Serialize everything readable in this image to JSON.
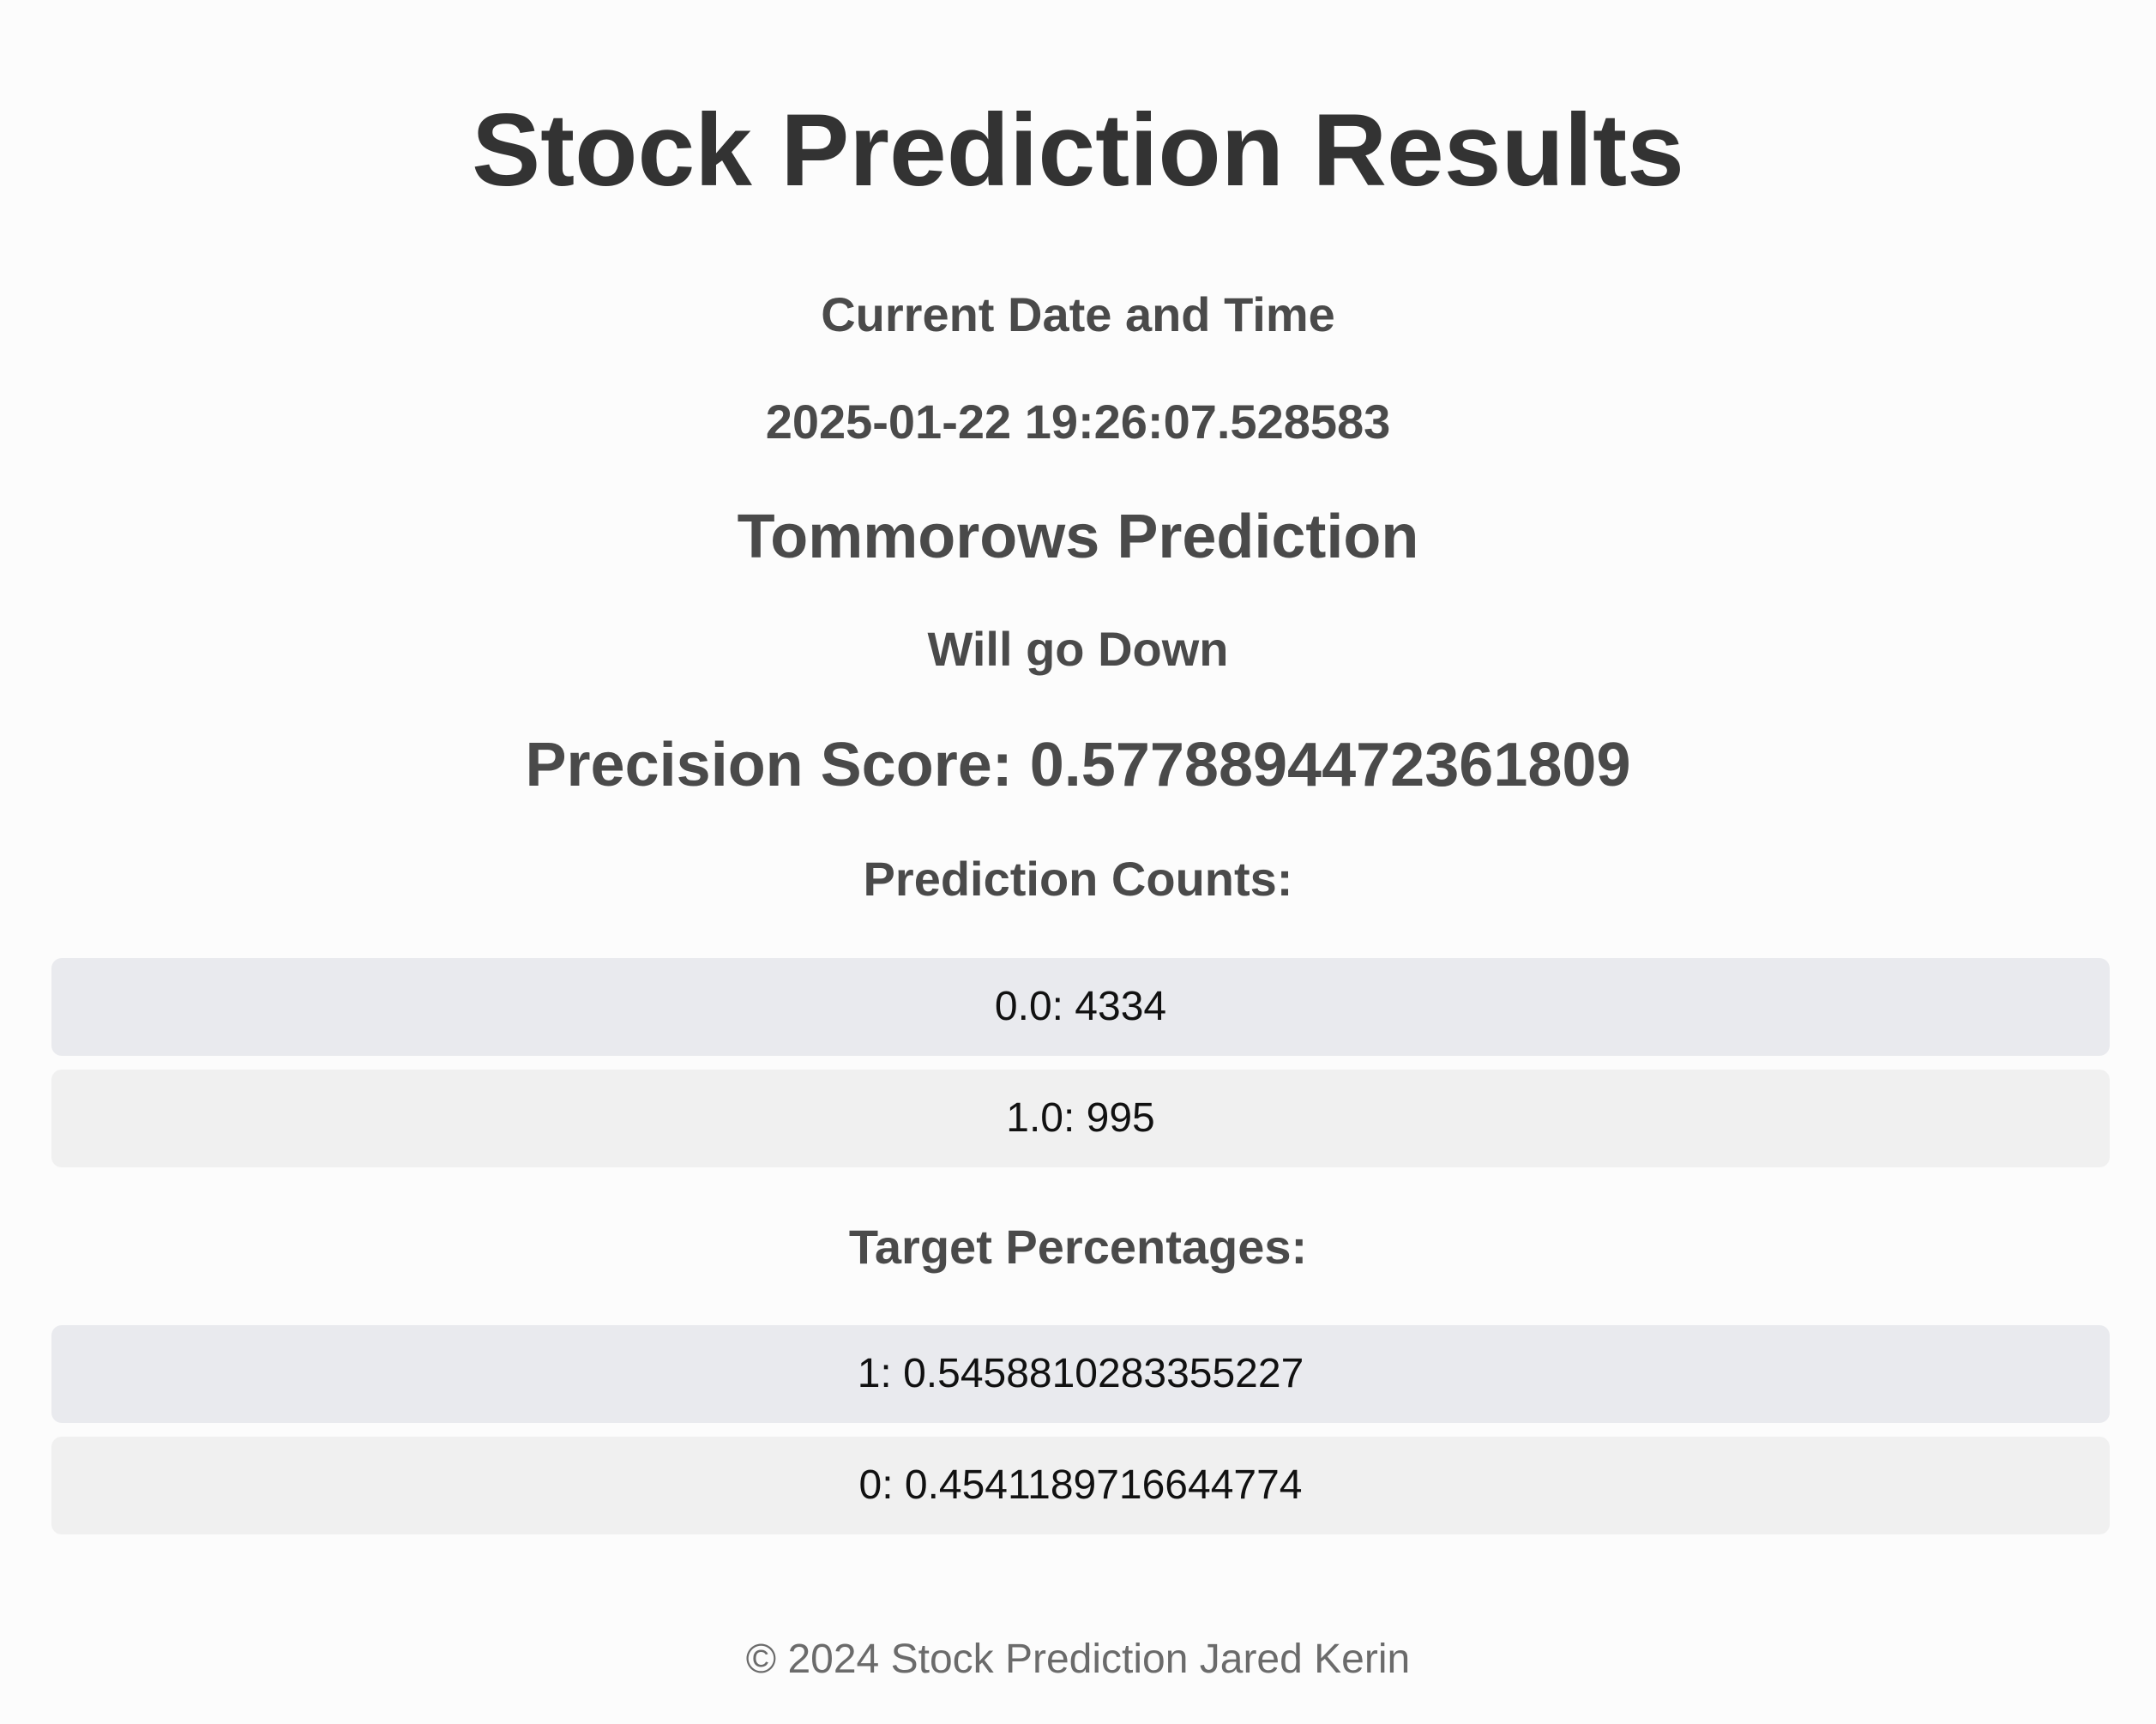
{
  "page": {
    "title": "Stock Prediction Results"
  },
  "datetime": {
    "heading": "Current Date and Time",
    "value": "2025-01-22 19:26:07.528583"
  },
  "prediction": {
    "heading": "Tommorows Prediction",
    "value": "Will go Down"
  },
  "precision": {
    "text": "Precision Score: 0.5778894472361809"
  },
  "prediction_counts": {
    "heading": "Prediction Counts:",
    "items": [
      "0.0: 4334",
      "1.0: 995"
    ]
  },
  "target_percentages": {
    "heading": "Target Percentages:",
    "items": [
      "1: 0.5458810283355227",
      "0: 0.4541189716644774"
    ]
  },
  "footer": {
    "text": "© 2024 Stock Prediction Jared Kerin"
  },
  "colors": {
    "background": "#fcfcfc",
    "title": "#333333",
    "label": "#4a4a4a",
    "row_alt": "#e9eaee",
    "row_plain": "#f0f0f0",
    "footer": "#6b6b6b"
  }
}
